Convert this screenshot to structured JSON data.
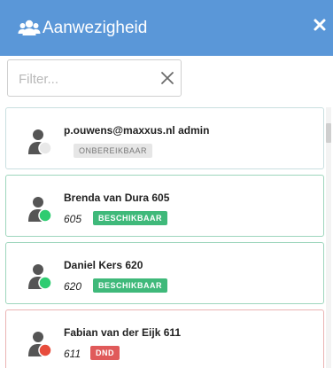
{
  "header": {
    "title": "Aanwezigheid",
    "users_icon": "users-icon",
    "close_icon": "close-icon"
  },
  "filter": {
    "placeholder": "Filter...",
    "value": "",
    "clear_icon": "clear-icon"
  },
  "contacts": [
    {
      "name": "p.ouwens@maxxus.nl admin",
      "extension": "",
      "status": "ONBEREIKBAAR",
      "status_color": "#e6e6e6",
      "dot_color": "#e8e8e8"
    },
    {
      "name": "Brenda van Dura 605",
      "extension": "605",
      "status": "BESCHIKBAAR",
      "status_color": "#3fb97a",
      "dot_color": "#2ecc71"
    },
    {
      "name": "Daniel Kers 620",
      "extension": "620",
      "status": "BESCHIKBAAR",
      "status_color": "#3fb97a",
      "dot_color": "#2ecc71"
    },
    {
      "name": "Fabian van der Eijk 611",
      "extension": "611",
      "status": "DND",
      "status_color": "#e05a5a",
      "dot_color": "#e74c3c"
    }
  ],
  "colors": {
    "header_bg": "#5a97d8",
    "available": "#3fb97a",
    "dnd": "#e05a5a"
  }
}
